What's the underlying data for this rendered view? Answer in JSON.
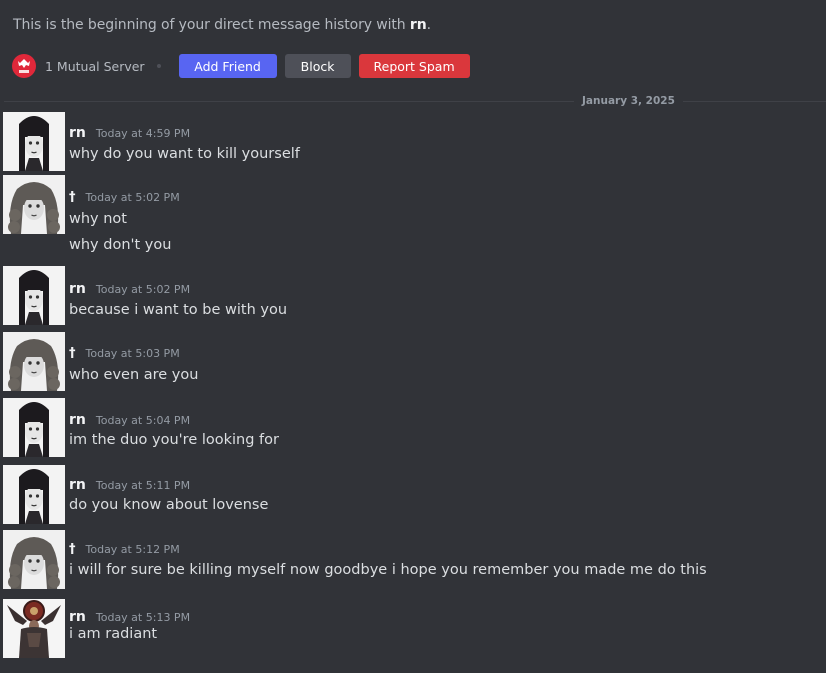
{
  "intro": {
    "prefix": "This is the beginning of your direct message history with ",
    "username": "rn",
    "suffix": "."
  },
  "actions": {
    "mutual_servers": "1 Mutual Server",
    "add_friend": "Add Friend",
    "block": "Block",
    "report_spam": "Report Spam"
  },
  "divider_date": "January 3, 2025",
  "messages": [
    {
      "author": "rn",
      "timestamp": "Today at 4:59 PM",
      "lines": [
        "why do you want to kill yourself"
      ],
      "avatar": "dark-haired-girl-portrait"
    },
    {
      "author": "†",
      "timestamp": "Today at 5:02 PM",
      "lines": [
        "why not",
        "why don't you"
      ],
      "avatar": "curly-haired-girl-portrait"
    },
    {
      "author": "rn",
      "timestamp": "Today at 5:02 PM",
      "lines": [
        "because i want to be with you"
      ],
      "avatar": "dark-haired-girl-portrait"
    },
    {
      "author": "†",
      "timestamp": "Today at 5:03 PM",
      "lines": [
        "who even are you"
      ],
      "avatar": "curly-haired-girl-portrait"
    },
    {
      "author": "rn",
      "timestamp": "Today at 5:04 PM",
      "lines": [
        "im the duo you're looking for"
      ],
      "avatar": "dark-haired-girl-portrait"
    },
    {
      "author": "rn",
      "timestamp": "Today at 5:11 PM",
      "lines": [
        "do you know about lovense"
      ],
      "avatar": "dark-haired-girl-portrait"
    },
    {
      "author": "†",
      "timestamp": "Today at 5:12 PM",
      "lines": [
        "i will for sure be killing myself now goodbye i hope you remember you made me do this"
      ],
      "avatar": "curly-haired-girl-portrait"
    },
    {
      "author": "rn",
      "timestamp": "Today at 5:13 PM",
      "lines": [
        "i am radiant"
      ],
      "avatar": "radiant-figure-portrait"
    }
  ]
}
